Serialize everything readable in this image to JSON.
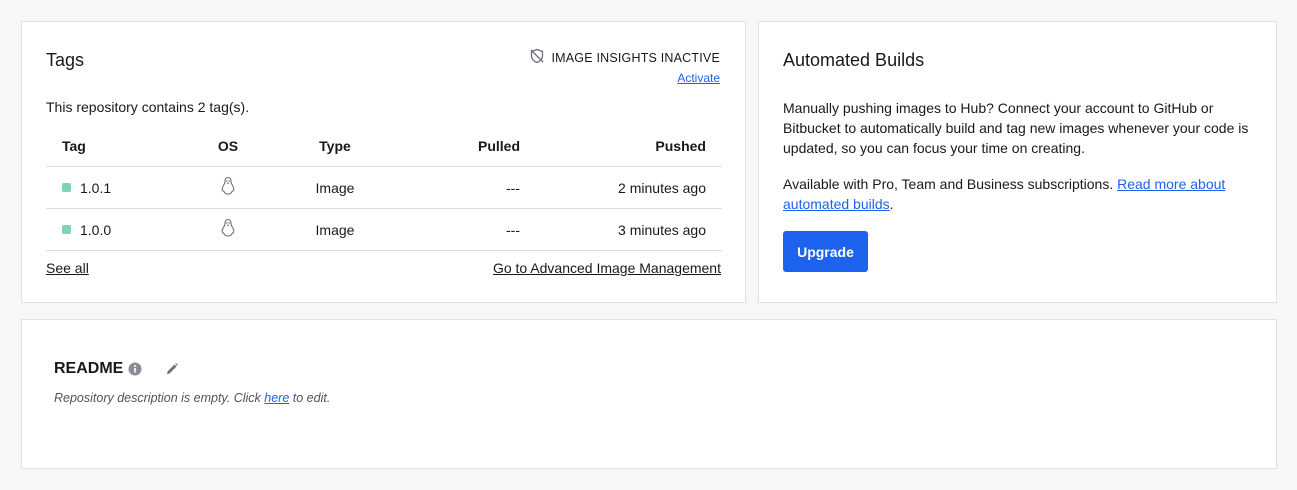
{
  "tags": {
    "title": "Tags",
    "insights_status": "IMAGE INSIGHTS INACTIVE",
    "insights_icon": "shield-off-icon",
    "activate_label": "Activate",
    "count_text": "This repository contains 2 tag(s).",
    "columns": [
      "Tag",
      "OS",
      "Type",
      "Pulled",
      "Pushed"
    ],
    "rows": [
      {
        "tag": "1.0.1",
        "os": "linux-icon",
        "type": "Image",
        "pulled": "---",
        "pushed": "2 minutes ago"
      },
      {
        "tag": "1.0.0",
        "os": "linux-icon",
        "type": "Image",
        "pulled": "---",
        "pushed": "3 minutes ago"
      }
    ],
    "status_color": "#7dd3b4",
    "see_all_label": "See all",
    "advanced_label": "Go to Advanced Image Management"
  },
  "builds": {
    "title": "Automated Builds",
    "description": "Manually pushing images to Hub? Connect your account to GitHub or Bitbucket to automatically build and tag new images whenever your code is updated, so you can focus your time on creating.",
    "availability": "Available with Pro, Team and Business subscriptions.",
    "read_more_label": "Read more about automated builds",
    "period": ".",
    "upgrade_label": "Upgrade",
    "accent_color": "#1d63ed"
  },
  "readme": {
    "title": "README",
    "info_icon": "info-icon",
    "edit_icon": "pencil-icon",
    "desc_before": "Repository description is empty. Click ",
    "desc_link": "here",
    "desc_after": " to edit."
  }
}
